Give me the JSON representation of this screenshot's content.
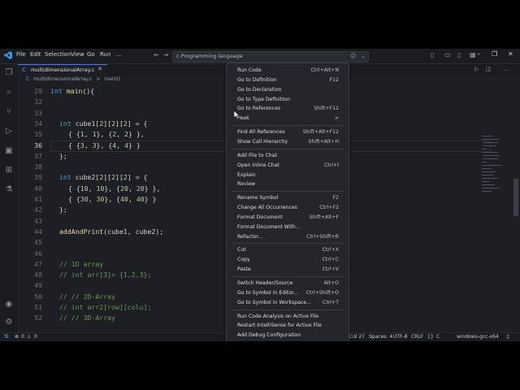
{
  "titlebar": {
    "menus": [
      "File",
      "Edit",
      "Selection",
      "View",
      "Go",
      "Run",
      "..."
    ],
    "search_placeholder": "c Programming language"
  },
  "tab": {
    "filename": "multidimensionalArray.c",
    "language_icon": "C"
  },
  "breadcrumb": [
    "C",
    "multidimensionalArray.c",
    ">",
    "main()"
  ],
  "editor": {
    "lines": [
      {
        "num": "29",
        "text": "int main(){"
      },
      {
        "num": "32",
        "text": ""
      },
      {
        "num": "33",
        "text": ""
      },
      {
        "num": "34",
        "text": "int cube1[2][2][2] = {"
      },
      {
        "num": "35",
        "text": "{ {1, 1}, {2, 2} },"
      },
      {
        "num": "36",
        "text": "{ {3, 3}, {4, 4} }"
      },
      {
        "num": "37",
        "text": "};"
      },
      {
        "num": "38",
        "text": ""
      },
      {
        "num": "39",
        "text": "int cube2[2][2][2] = {"
      },
      {
        "num": "40",
        "text": "{ {10, 10}, {20, 20} },"
      },
      {
        "num": "41",
        "text": "{ {30, 30}, {40, 40} }"
      },
      {
        "num": "42",
        "text": "};"
      },
      {
        "num": "43",
        "text": ""
      },
      {
        "num": "44",
        "text": "addAndPrint(cube1, cube2);"
      },
      {
        "num": "45",
        "text": ""
      },
      {
        "num": "46",
        "text": ""
      },
      {
        "num": "47",
        "text": "// 1D array"
      },
      {
        "num": "48",
        "text": "// int arr[3]= {1,2,3};"
      },
      {
        "num": "49",
        "text": ""
      },
      {
        "num": "50",
        "text": "// // 2D-Array"
      },
      {
        "num": "51",
        "text": "// int arr2[row][colu];"
      },
      {
        "num": "52",
        "text": "// // 3D-Array"
      }
    ]
  },
  "context_menu": {
    "items": [
      {
        "label": "Run Code",
        "shortcut": "Ctrl+Alt+N"
      },
      {
        "label": "Go to Definition",
        "shortcut": "F12"
      },
      {
        "label": "Go to Declaration",
        "shortcut": ""
      },
      {
        "label": "Go to Type Definition",
        "shortcut": ""
      },
      {
        "label": "Go to References",
        "shortcut": "Shift+F12"
      },
      {
        "label": "Peek",
        "shortcut": ">"
      },
      {
        "label": "Find All References",
        "shortcut": "Shift+Alt+F12"
      },
      {
        "label": "Show Call Hierarchy",
        "shortcut": "Shift+Alt+H"
      },
      {
        "label": "Add File to Chat",
        "shortcut": ""
      },
      {
        "label": "Open Inline Chat",
        "shortcut": "Ctrl+I"
      },
      {
        "label": "Explain",
        "shortcut": ""
      },
      {
        "label": "Review",
        "shortcut": ""
      },
      {
        "label": "Rename Symbol",
        "shortcut": "F2"
      },
      {
        "label": "Change All Occurrences",
        "shortcut": "Ctrl+F2"
      },
      {
        "label": "Format Document",
        "shortcut": "Shift+Alt+F"
      },
      {
        "label": "Format Document With...",
        "shortcut": ""
      },
      {
        "label": "Refactor...",
        "shortcut": "Ctrl+Shift+R"
      },
      {
        "label": "Cut",
        "shortcut": "Ctrl+X"
      },
      {
        "label": "Copy",
        "shortcut": "Ctrl+C"
      },
      {
        "label": "Paste",
        "shortcut": "Ctrl+V"
      },
      {
        "label": "Switch Header/Source",
        "shortcut": "Alt+O"
      },
      {
        "label": "Go to Symbol in Editor...",
        "shortcut": "Ctrl+Shift+O"
      },
      {
        "label": "Go to Symbol in Workspace...",
        "shortcut": "Ctrl+T"
      },
      {
        "label": "Run Code Analysis on Active File",
        "shortcut": ""
      },
      {
        "label": "Restart IntelliSense for Active File",
        "shortcut": ""
      },
      {
        "label": "Add Debug Configuration",
        "shortcut": ""
      }
    ]
  },
  "statusbar": {
    "errors": "0",
    "warnings": "0",
    "position": "Col 27",
    "spaces": "Spaces: 4",
    "encoding": "UTF-8",
    "eol": "CRLF",
    "language": "C",
    "config": "windows-gcc-x64"
  },
  "colors": {
    "background": "#1e1f24",
    "accent": "#4c6ef5",
    "keyword": "#c586c0",
    "type": "#569cd6",
    "function": "#dcdcaa",
    "number": "#b5cea8",
    "comment": "#6a9955"
  }
}
